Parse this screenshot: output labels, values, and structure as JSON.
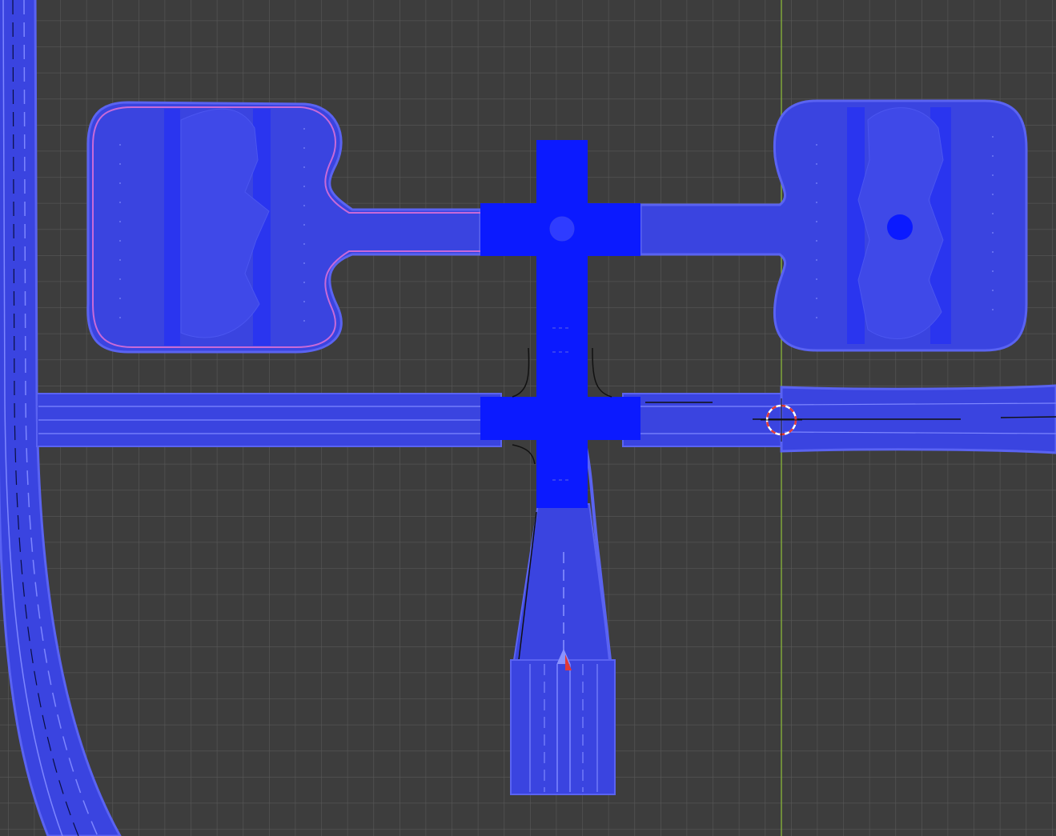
{
  "viewport": {
    "background": "#3d3d3d",
    "grid_minor_color": "#5a5a5a",
    "grid_axis_color": "#7fa63a"
  },
  "colors": {
    "road_fill": "#3a44e0",
    "road_edge": "#5a63f2",
    "road_lane_line": "#8a93ff",
    "junction_solid": "#0b1aff",
    "selection_outline": "#c86ad8",
    "curve_line": "#111111",
    "cursor_red": "#e23838",
    "cursor_white": "#ffffff"
  },
  "scene": {
    "objects": [
      "highway-curve",
      "left-roundabout-lot",
      "right-roundabout-lot",
      "center-junction",
      "east-west-road",
      "south-road",
      "south-ramp"
    ]
  }
}
